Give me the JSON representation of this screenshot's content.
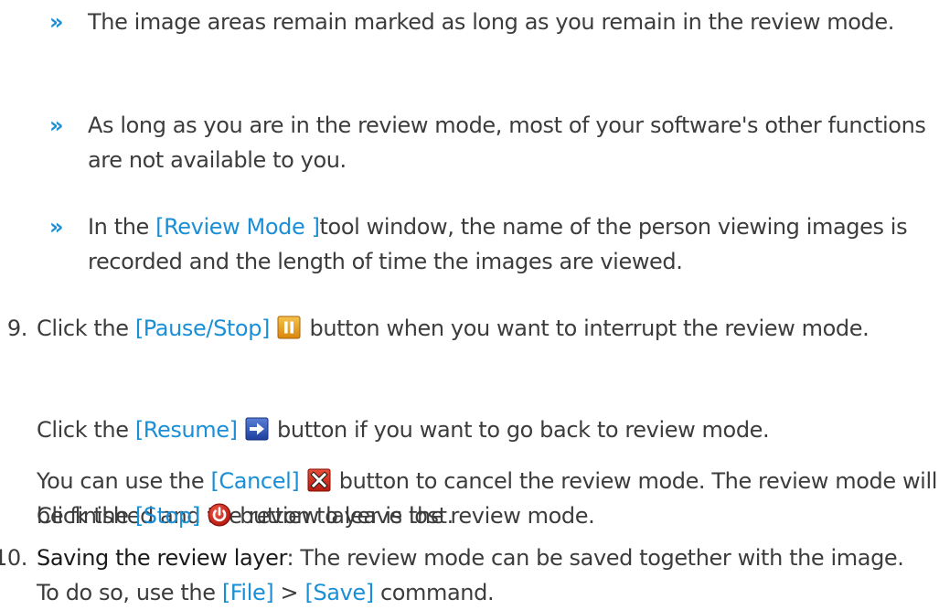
{
  "bullets": [
    {
      "mark": "»",
      "text": "The image areas remain marked as long as you remain in the review mode."
    },
    {
      "mark": "»",
      "text": "As long as you are in the review mode, most of your software's other functions are not available to you."
    },
    {
      "mark": "»",
      "pre": "In the ",
      "link": "[Review Mode ]",
      "post": "tool window, the name of the person viewing images is recorded and the length of time the images are viewed."
    }
  ],
  "step9": {
    "number": "9.",
    "pre": "Click the ",
    "link": "[Pause/Stop]",
    "icon": "pause-icon",
    "post": " button when you want to interrupt the review mode."
  },
  "resume_para": {
    "pre": "Click the ",
    "link": "[Resume]",
    "icon": "arrow-right-icon",
    "post": " button if you want to go back to review mode."
  },
  "cancel_para": {
    "pre": "You can use the ",
    "link": "[Cancel]",
    "icon": "cancel-x-icon",
    "post": " button to cancel the review mode. The review mode will be finished and the review layer is lost."
  },
  "stop_para": {
    "pre": "Click the ",
    "link": "[Stop]",
    "icon": "stop-power-icon",
    "post": " button to leave the review mode."
  },
  "step10": {
    "number": "10.",
    "strong": "Saving the review layer",
    "post1": ": The review mode can be saved together with the image. To do so, use the ",
    "link1": "[File]",
    "sep": " > ",
    "link2": "[Save]",
    "post2": " command."
  },
  "colors": {
    "link": "#1b8fd6",
    "text": "#3c3c3c"
  }
}
